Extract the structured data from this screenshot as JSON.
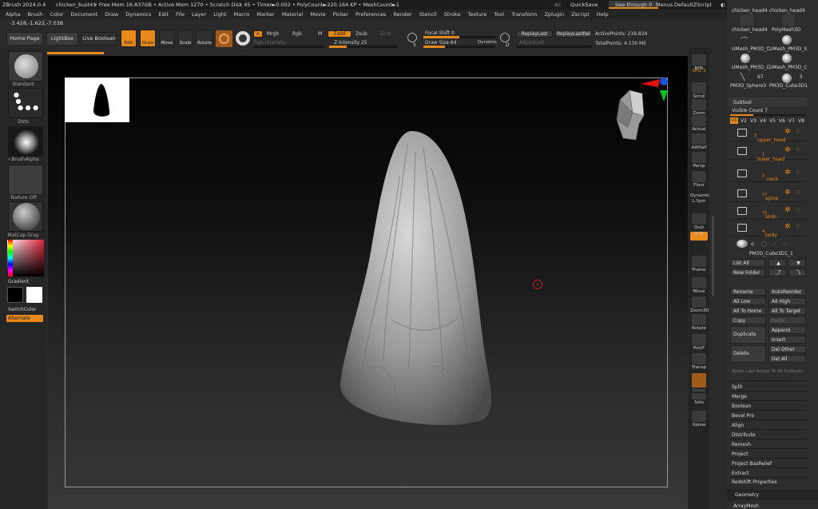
{
  "titlebar": {
    "app": "ZBrush 2024.0.4",
    "file": "chicken_bust41",
    "stats": "• Free Mem 16.837GB • Active Mem 1270 • Scratch Disk 45 • Timer►0.002 • PolyCount►220.164 KP • MeshCount►1",
    "ac": "AC",
    "quicksave": "QuickSave",
    "seethrough": "See-through  0",
    "menus": "Menus",
    "script": "DefaultZScript"
  },
  "menubar": [
    "Alpha",
    "Brush",
    "Color",
    "Document",
    "Draw",
    "Dynamics",
    "Edit",
    "File",
    "Layer",
    "Light",
    "Macro",
    "Marker",
    "Material",
    "Movie",
    "Picker",
    "Preferences",
    "Render",
    "Stencil",
    "Stroke",
    "Texture",
    "Tool",
    "Transform",
    "Zplugin",
    "Zscript",
    "Help"
  ],
  "coords": "-3.428,-1.622,-7.038",
  "toolbar": {
    "home": "Home Page",
    "lightbox": "LightBox",
    "liveboolean": "Live Boolean",
    "edit": "Edit",
    "draw": "Draw",
    "move": "Move",
    "scale": "Scale",
    "rotate": "Rotate",
    "a": "A",
    "mrgb": "Mrgb",
    "rgb": "Rgb",
    "m": "M",
    "zadd": "Zadd",
    "zsub": "Zsub",
    "zcut": "Zcut",
    "rgbint": "Rgb Intensity",
    "zint": "Z Intensity 25",
    "focal": "Focal Shift 0",
    "drawsize": "Draw Size 64",
    "dynamic": "Dynamic",
    "s": "S",
    "d": "D",
    "replay": "ReplayLast",
    "replayrel": "ReplayLastRel",
    "adjust": "AdjustLast",
    "active": "ActivePoints: 218,824",
    "total": "TotalPoints: 4.130 Mil"
  },
  "leftshelf": {
    "standard": "Standard",
    "dots": "Dots",
    "brushalpha": "~BrushAlpha",
    "textureoff": "Texture Off",
    "matcap": "MatCap Gray",
    "gradient": "Gradient",
    "switchcolor": "SwitchColor",
    "alternate": "Alternate"
  },
  "rightshelf": [
    {
      "n": "BPR",
      "t": 87
    },
    {
      "n": "SPix 3",
      "t": 103
    },
    {
      "n": "Scroll",
      "t": 117
    },
    {
      "n": "Zoom",
      "t": 137
    },
    {
      "n": "Actual",
      "t": 157
    },
    {
      "n": "AAHalf",
      "t": 180
    },
    {
      "n": "Persp",
      "t": 203
    },
    {
      "n": "Floor",
      "t": 226
    },
    {
      "n": "Dynamic",
      "t": 243
    },
    {
      "n": "L.Sym",
      "t": 255
    },
    {
      "n": "Qviz",
      "t": 278
    },
    {
      "n": "XYZ",
      "t": 292
    },
    {
      "n": "Frame",
      "t": 333
    },
    {
      "n": "Move",
      "t": 360
    },
    {
      "n": "Zoom3D",
      "t": 383
    },
    {
      "n": "Rotate",
      "t": 405
    },
    {
      "n": "PolyF",
      "t": 430
    },
    {
      "n": "Transp",
      "t": 455
    },
    {
      "n": "Ghost",
      "t": 486
    },
    {
      "n": "Solo",
      "t": 503
    },
    {
      "n": "Xpose",
      "t": 527
    }
  ],
  "tools": [
    {
      "name": "chicken_head4",
      "icon": "wave-icon"
    },
    {
      "name": "chicken_head4",
      "icon": "wave-icon"
    },
    {
      "name": "chicken_head4",
      "icon": "wave-icon"
    },
    {
      "name": "PolyMesh3D",
      "icon": "star-icon"
    },
    {
      "name": "UMesh_PM3D_C",
      "icon": "wave-icon"
    },
    {
      "name": "UMesh_PM3D_S",
      "icon": "sphere-icon"
    },
    {
      "name": "UMesh_PM3D_C",
      "icon": "sphere-icon"
    },
    {
      "name": "UMesh_PM3D_C",
      "icon": "sphere-icon"
    },
    {
      "name": "PM3D_Sphere3",
      "icon": "sphere-icon"
    },
    {
      "name": "PM3D_Cube3D1",
      "icon": "cube-icon"
    }
  ],
  "tool_badges": {
    "b1": "67",
    "b2": "5"
  },
  "subtool": {
    "title": "Subtool",
    "visible": "Visible Count 7",
    "tabs": [
      "V1",
      "V2",
      "V3",
      "V4",
      "V5",
      "V6",
      "V7",
      "V8"
    ],
    "rows": [
      {
        "num": "3",
        "name": "upper_head"
      },
      {
        "num": "1",
        "name": "lower_head"
      },
      {
        "num": "2",
        "name": "neck"
      },
      {
        "num": "17",
        "name": "spine"
      },
      {
        "num": "72",
        "name": "skob"
      },
      {
        "num": "4",
        "name": "body"
      }
    ],
    "mesh": "PM3D_Cube3D1_1",
    "listall": "List All",
    "newfolder": "New Folder",
    "rename": "Rename",
    "autoreorder": "AutoReorder",
    "alllow": "All Low",
    "allhigh": "All High",
    "alltohome": "All To Home",
    "alltotarget": "All To Target",
    "copy": "Copy",
    "paste": "Paste",
    "duplicate": "Duplicate",
    "append": "Append",
    "insert": "Insert",
    "delete": "Delete",
    "delother": "Del Other",
    "delall": "Del All",
    "applylast": "Apply Last Action To All Subtools"
  },
  "subtool_list": [
    "Split",
    "Merge",
    "Boolean",
    "Bevel Pro",
    "Align",
    "Distribute",
    "Remesh",
    "Project",
    "Project BasRelief",
    "Extract",
    "Redshift Properties"
  ],
  "geometry": "Geometry",
  "arraymesh": "ArrayMesh"
}
